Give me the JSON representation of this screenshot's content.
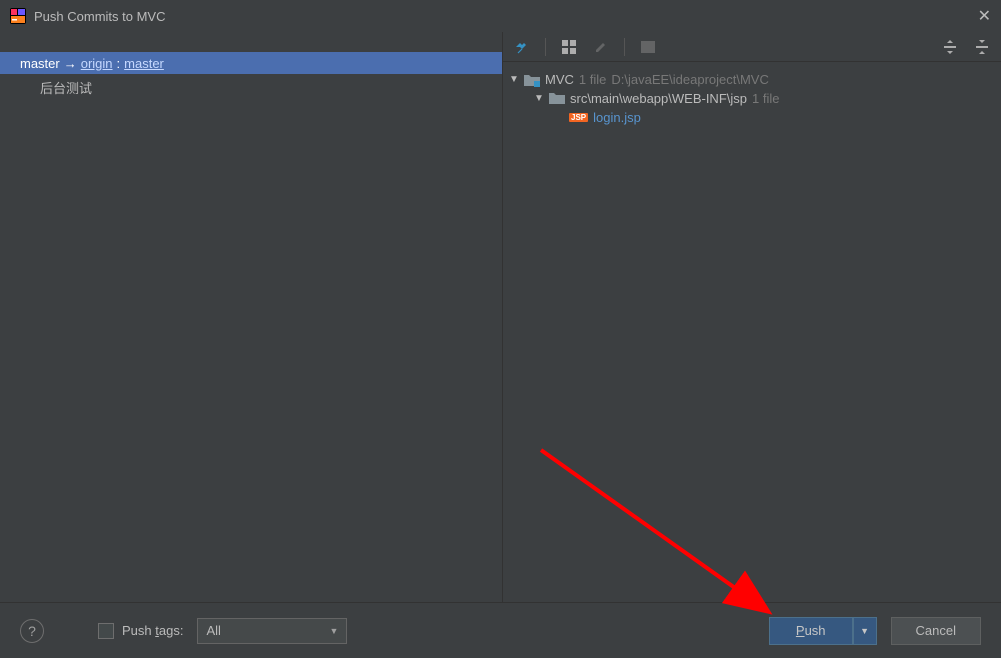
{
  "title": "Push Commits to MVC",
  "left": {
    "local_branch": "master",
    "remote": "origin",
    "remote_branch": "master",
    "commits": [
      "后台测试"
    ]
  },
  "right": {
    "project": {
      "name": "MVC",
      "file_count": "1 file",
      "path": "D:\\javaEE\\ideaproject\\MVC"
    },
    "folder": {
      "name": "src\\main\\webapp\\WEB-INF\\jsp",
      "file_count": "1 file"
    },
    "file": {
      "name": "login.jsp",
      "badge": "JSP"
    }
  },
  "footer": {
    "help": "?",
    "push_tags_label_prefix": "Push ",
    "push_tags_label_underline": "t",
    "push_tags_label_suffix": "ags:",
    "dropdown_value": "All",
    "push_label_underline": "P",
    "push_label_suffix": "ush",
    "cancel_label": "Cancel"
  }
}
